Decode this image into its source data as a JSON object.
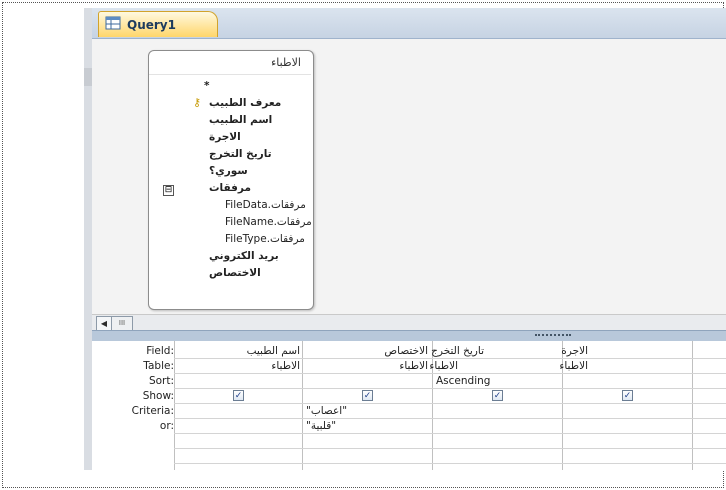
{
  "tab": {
    "title": "Query1",
    "icon": "query-icon"
  },
  "table": {
    "title": "الاطباء",
    "fields": [
      "*",
      "معرف الطبيب",
      "اسم الطبيب",
      "الاجرة",
      "تاريخ التخرج",
      "سوري؟",
      "مرفقات",
      "مرفقات.FileData",
      "مرفقات.FileName",
      "مرفقات.FileType",
      "بريد الكتروني",
      "الاختصاص"
    ],
    "key_field": "معرف الطبيب",
    "expand_symbol": "⊟"
  },
  "scroll": {
    "left_arrow": "◀",
    "thumb": "III"
  },
  "grid": {
    "row_labels": [
      "Field:",
      "Table:",
      "Sort:",
      "Show:",
      "Criteria:",
      "or:"
    ],
    "columns": [
      {
        "field": "اسم الطبيب",
        "table": "الاطباء",
        "sort": "",
        "show": true,
        "criteria": "",
        "or": ""
      },
      {
        "field": "الاختصاص",
        "table": "الاطباء",
        "sort": "",
        "show": true,
        "criteria": "\"اعصاب\"",
        "or": "\"قلبية\""
      },
      {
        "field": "تاريخ التخرج",
        "table": "الاطباء",
        "sort": "Ascending",
        "show": true,
        "criteria": "",
        "or": ""
      },
      {
        "field": "الاجرة",
        "table": "الاطباء",
        "sort": "",
        "show": true,
        "criteria": "",
        "or": ""
      }
    ]
  },
  "colors": {
    "tab_active": "#ffd66b",
    "splitter": "#b8c8da",
    "checkbox_mark": "#1f3f8a"
  }
}
